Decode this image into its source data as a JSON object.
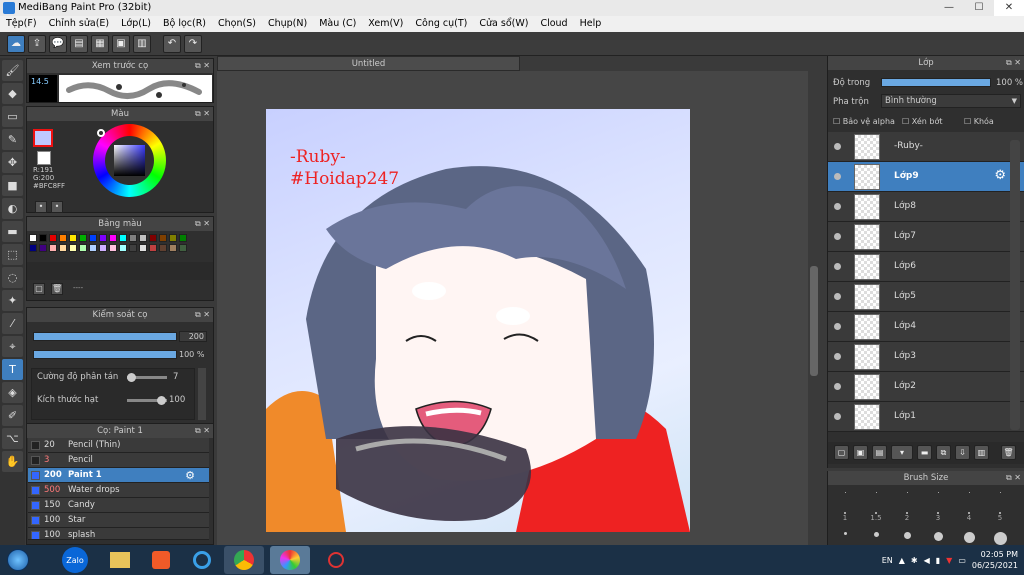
{
  "window": {
    "title": "MediBang Paint Pro (32bit)",
    "min": "—",
    "max": "☐",
    "close": "✕"
  },
  "menu": [
    "Tệp(F)",
    "Chỉnh sửa(E)",
    "Lớp(L)",
    "Bộ lọc(R)",
    "Chọn(S)",
    "Chụp(N)",
    "Màu (C)",
    "Xem(V)",
    "Công cụ(T)",
    "Cửa sổ(W)",
    "Cloud",
    "Help"
  ],
  "toolbar": {
    "icons": [
      "☁",
      "⇪",
      "💬",
      "▤",
      "▦",
      "▣",
      "▥",
      "↶",
      "↷"
    ]
  },
  "left_tools": [
    "🖌",
    "◆",
    "▭",
    "✎",
    "✥",
    "■",
    "◐",
    "▬",
    "⬚",
    "◌",
    "✦",
    "⁄",
    "⌖",
    "T",
    "◈",
    "✐",
    "⌥",
    "✋"
  ],
  "panels": {
    "brush_preview": {
      "title": "Xem trước cọ",
      "size": "14.5"
    },
    "color": {
      "title": "Màu",
      "r": "R:191",
      "g": "G:200",
      "hex": "#BFC8FF"
    },
    "palette": {
      "title": "Bảng màu",
      "footer": "----"
    },
    "control": {
      "title": "Kiểm soát cọ",
      "size_val": "200",
      "opacity_val": "100 %",
      "scatter_label": "Cường độ phân tán",
      "scatter_val": "7",
      "particle_label": "Kích thước hạt",
      "particle_val": "100"
    },
    "brush": {
      "title": "Cọ: Paint 1",
      "items": [
        {
          "size": "20",
          "name": "Pencil (Thin)"
        },
        {
          "size": "3",
          "name": "Pencil"
        },
        {
          "size": "200",
          "name": "Paint 1"
        },
        {
          "size": "500",
          "name": "Water drops"
        },
        {
          "size": "150",
          "name": "Candy"
        },
        {
          "size": "100",
          "name": "Star"
        },
        {
          "size": "100",
          "name": "splash"
        }
      ]
    }
  },
  "canvas": {
    "tab": "Untitled",
    "text1": "-Ruby-",
    "text2": "#Hoidap247"
  },
  "layers": {
    "title": "Lớp",
    "opacity_label": "Độ trong",
    "opacity_val": "100 %",
    "blend_label": "Pha trộn",
    "blend_val": "Bình thường",
    "alpha_protect": "Bảo vệ alpha",
    "clipping": "Xén bớt",
    "lock": "Khóa",
    "items": [
      "-Ruby-",
      "Lớp9",
      "Lớp8",
      "Lớp7",
      "Lớp6",
      "Lớp5",
      "Lớp4",
      "Lớp3",
      "Lớp2",
      "Lớp1"
    ]
  },
  "brush_size": {
    "title": "Brush Size",
    "labels": [
      "1",
      "1.5",
      "2",
      "3",
      "4",
      "5"
    ]
  },
  "taskbar": {
    "apps": [
      "Zalo"
    ],
    "lang": "EN",
    "time": "02:05 PM",
    "date": "06/25/2021"
  }
}
